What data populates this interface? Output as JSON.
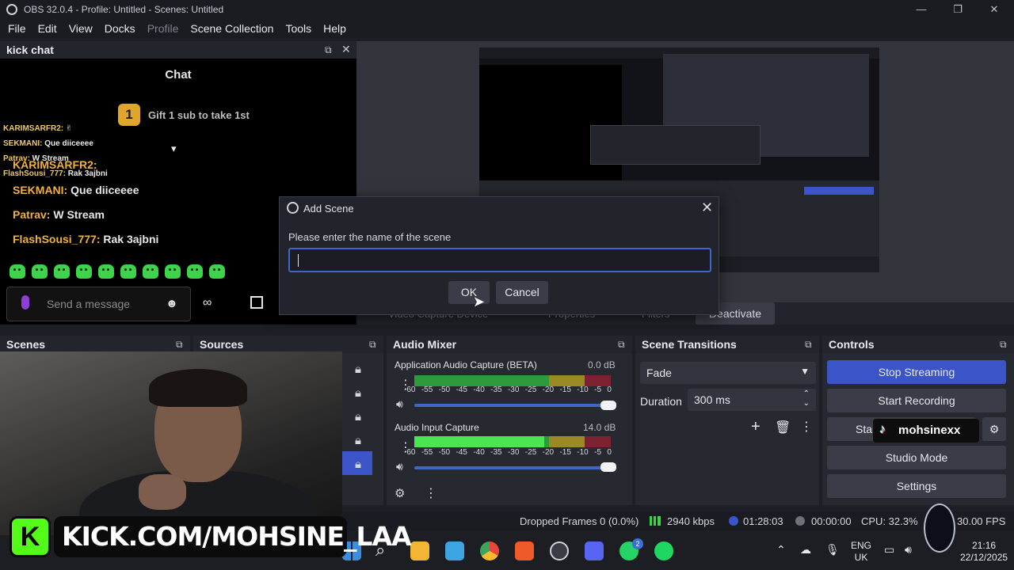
{
  "window": {
    "title": "OBS 32.0.4 - Profile: Untitled - Scenes: Untitled",
    "controls": [
      "—",
      "❐",
      "✕"
    ]
  },
  "menu": [
    "File",
    "Edit",
    "View",
    "Docks",
    "Profile",
    "Scene Collection",
    "Tools",
    "Help"
  ],
  "chat_dock": {
    "title": "kick chat",
    "header": "Chat",
    "gift_badge": "1",
    "gift_text": "Gift 1 sub to take 1st",
    "overlay_messages": [
      {
        "user": "KARIMSARFR2:",
        "text": ""
      },
      {
        "user": "SEKMANI:",
        "text": " Que diiceeee"
      },
      {
        "user": "Patrav:",
        "text": " W Stream"
      },
      {
        "user": "FlashSousi_777:",
        "text": " Rak 3ajbni"
      }
    ],
    "messages": [
      {
        "user": "KARIMSARFR2:",
        "text": ""
      },
      {
        "user": "SEKMANI:",
        "text": " Que diiceeee"
      },
      {
        "user": "Patrav:",
        "text": " W Stream"
      },
      {
        "user": "FlashSousi_777:",
        "text": " Rak 3ajbni"
      }
    ],
    "send_placeholder": "Send a message"
  },
  "dialog": {
    "title": "Add Scene",
    "prompt": "Please enter the name of the scene",
    "input_value": "",
    "ok": "OK",
    "cancel": "Cancel"
  },
  "control_strip": {
    "source": "Video Capture Device",
    "properties": "Properties",
    "filters": "Filters",
    "deactivate": "Deactivate"
  },
  "docks": {
    "scenes": "Scenes",
    "sources": "Sources",
    "audio_mixer": "Audio Mixer",
    "scene_transitions": "Scene Transitions",
    "controls": "Controls"
  },
  "mixer": {
    "scale": [
      "-60",
      "-55",
      "-50",
      "-45",
      "-40",
      "-35",
      "-30",
      "-25",
      "-20",
      "-15",
      "-10",
      "-5",
      "0"
    ],
    "channels": [
      {
        "name": "Application Audio Capture (BETA)",
        "db": "0.0 dB",
        "level": 0
      },
      {
        "name": "Audio Input Capture",
        "db": "14.0 dB",
        "level": 0.66
      }
    ]
  },
  "transitions": {
    "selected": "Fade",
    "duration_label": "Duration",
    "duration_value": "300 ms"
  },
  "controls": {
    "stop_streaming": "Stop Streaming",
    "start_recording": "Start Recording",
    "start_vcam_partial": "Star",
    "studio_mode": "Studio Mode",
    "settings": "Settings"
  },
  "status": {
    "dropped_frames": "Dropped Frames 0 (0.0%)",
    "bitrate": "2940 kbps",
    "stream_time": "01:28:03",
    "record_time": "00:00:00",
    "cpu": "CPU: 32.3%",
    "fps": "30.00 FPS"
  },
  "taskbar": {
    "language": "ENG",
    "region": "UK",
    "time": "21:16",
    "date": "22/12/2025",
    "whatsapp_badge": "2"
  },
  "overlay": {
    "kick_logo": "K",
    "kick_url": "KICK.COM/MOHSINE_LAA",
    "tiktok": "mohsinexx"
  },
  "colors": {
    "accent": "#3b55c8",
    "kick_green": "#53fc18",
    "chat_user": "#f0b23d"
  }
}
